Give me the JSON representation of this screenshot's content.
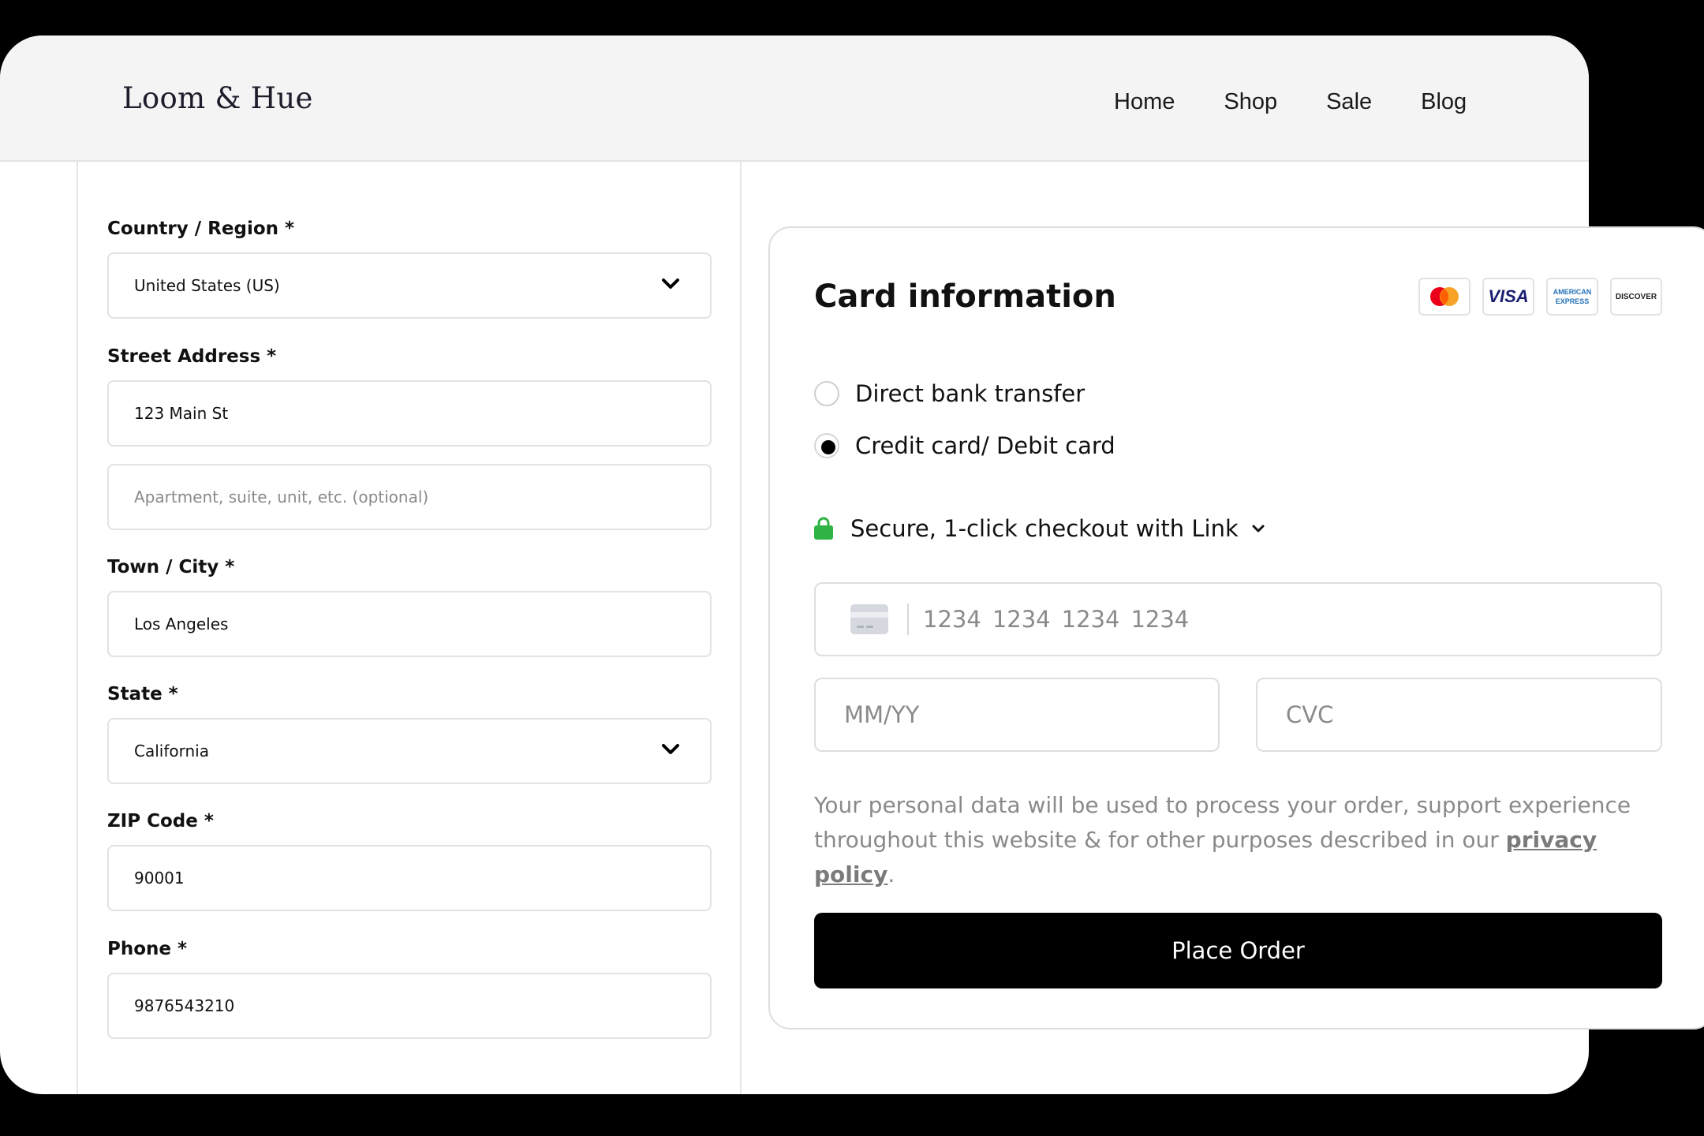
{
  "header": {
    "brand": "Loom & Hue",
    "nav": [
      "Home",
      "Shop",
      "Sale",
      "Blog"
    ]
  },
  "billing": {
    "country_label": "Country / Region *",
    "country_value": "United States (US)",
    "street_label": "Street Address *",
    "street_value": "123 Main St",
    "apartment_placeholder": "Apartment, suite, unit, etc. (optional)",
    "city_label": "Town / City *",
    "city_value": "Los Angeles",
    "state_label": "State *",
    "state_value": "California",
    "zip_label": "ZIP Code *",
    "zip_value": "90001",
    "phone_label": "Phone *",
    "phone_value": "9876543210"
  },
  "payment": {
    "title": "Card information",
    "card_brands": {
      "visa": "VISA",
      "amex_line1": "AMERICAN",
      "amex_line2": "EXPRESS",
      "discover": "DISCOVER"
    },
    "brand_icons": [
      "mastercard-logo",
      "visa-logo",
      "american-express-logo",
      "discover-logo"
    ],
    "method_bank": "Direct bank transfer",
    "method_card": "Credit card/ Debit card",
    "selected_method": "Credit card/ Debit card",
    "link_text": "Secure, 1-click checkout with Link",
    "card_number_groups": [
      "1234",
      "1234",
      "1234",
      "1234"
    ],
    "expiry_placeholder": "MM/YY",
    "cvc_placeholder": "CVC",
    "notice_text": "Your personal data will be used to process your order, support experience throughout this website & for other purposes described in our ",
    "notice_link": "privacy policy",
    "notice_end": ".",
    "place_order": "Place Order"
  },
  "colors": {
    "lock": "#2fb344",
    "button": "#000000",
    "mastercard_red": "#eb001b",
    "mastercard_orange": "#f79e1b",
    "visa_blue": "#1a1f71",
    "amex_blue": "#2671b9"
  }
}
